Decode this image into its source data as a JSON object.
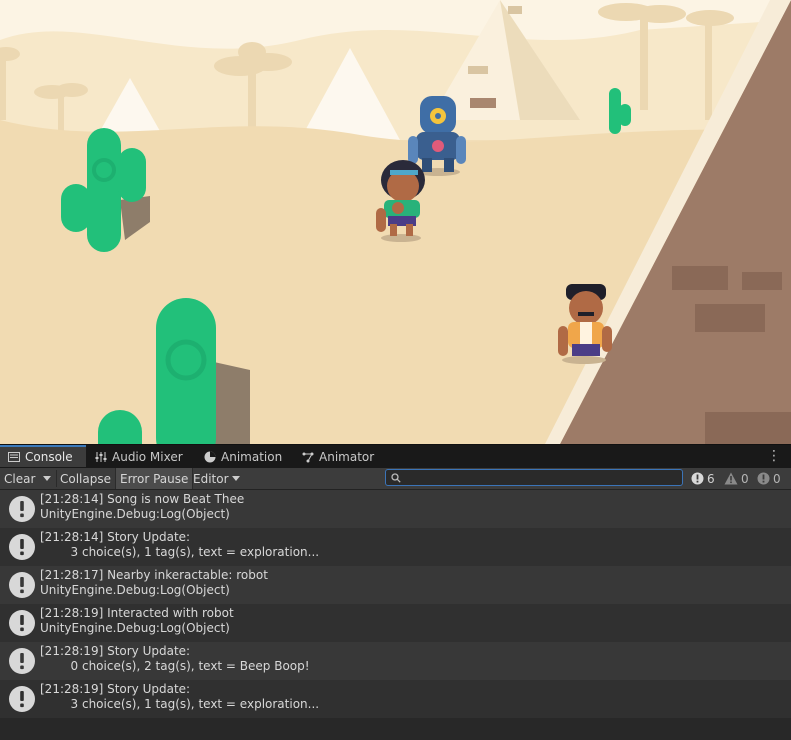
{
  "scene": {
    "colors": {
      "sky": "#fdf6ea",
      "dune": "#f3dfb8",
      "far_dune": "#f5e6c6",
      "cactus": "#22c07a",
      "pyramid_dark": "#9b7a66",
      "pyramid_light": "#f7ecd8"
    }
  },
  "tabs": [
    {
      "label": "Console",
      "icon": "console-icon"
    },
    {
      "label": "Audio Mixer",
      "icon": "audio-mixer-icon"
    },
    {
      "label": "Animation",
      "icon": "animation-icon"
    },
    {
      "label": "Animator",
      "icon": "animator-icon"
    }
  ],
  "toolbar": {
    "clear": "Clear",
    "collapse": "Collapse",
    "error_pause": "Error Pause",
    "editor": "Editor",
    "search_value": "",
    "log_count": "6",
    "warning_count": "0",
    "error_count": "0"
  },
  "log_entries": [
    {
      "line1": "[21:28:14] Song is now Beat Thee",
      "line2": "UnityEngine.Debug:Log(Object)"
    },
    {
      "line1": "[21:28:14] Story Update:",
      "line2": "        3 choice(s), 1 tag(s), text = exploration..."
    },
    {
      "line1": "[21:28:17] Nearby inkeractable: robot",
      "line2": "UnityEngine.Debug:Log(Object)"
    },
    {
      "line1": "[21:28:19] Interacted with robot",
      "line2": "UnityEngine.Debug:Log(Object)"
    },
    {
      "line1": "[21:28:19] Story Update:",
      "line2": "        0 choice(s), 2 tag(s), text = Beep Boop!"
    },
    {
      "line1": "[21:28:19] Story Update:",
      "line2": "        3 choice(s), 1 tag(s), text = exploration..."
    }
  ]
}
